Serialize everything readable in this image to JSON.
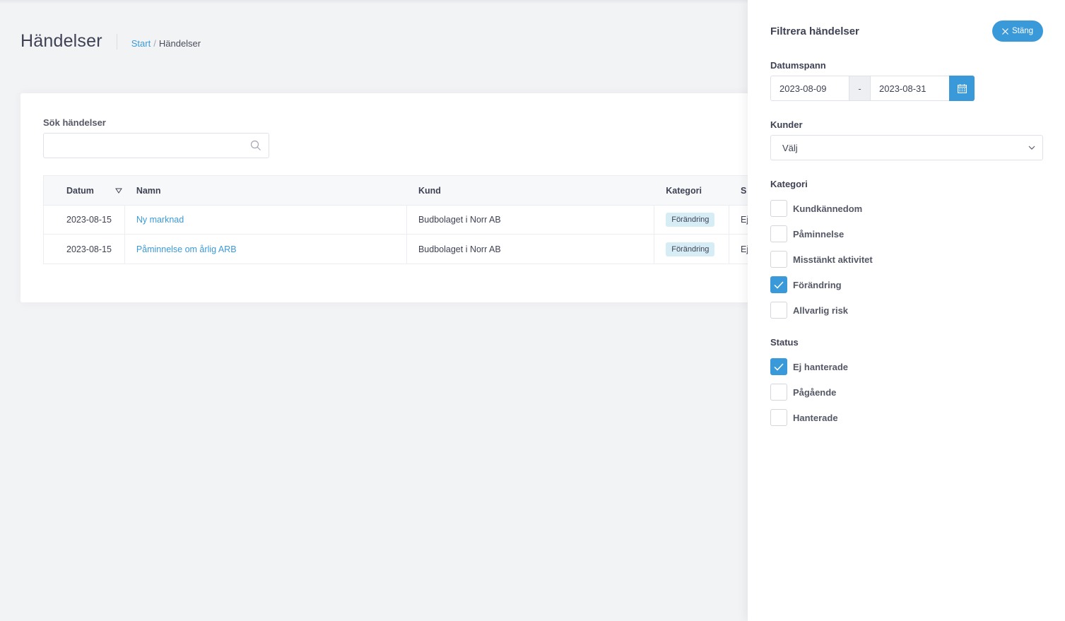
{
  "header": {
    "title": "Händelser",
    "breadcrumb": {
      "start": "Start",
      "separator": "/",
      "current": "Händelser"
    }
  },
  "search": {
    "label": "Sök händelser",
    "placeholder": "",
    "value": ""
  },
  "table": {
    "columns": [
      "Datum",
      "Namn",
      "Kund",
      "Kategori",
      "S"
    ],
    "rows": [
      {
        "datum": "2023-08-15",
        "namn": "Ny marknad",
        "kund": "Budbolaget i Norr AB",
        "kategori": "Förändring",
        "status": "Ej"
      },
      {
        "datum": "2023-08-15",
        "namn": "Påminnelse om årlig ARB",
        "kund": "Budbolaget i Norr AB",
        "kategori": "Förändring",
        "status": "Ej"
      }
    ]
  },
  "filter_panel": {
    "title": "Filtrera händelser",
    "close_label": "Stäng",
    "date_range": {
      "label": "Datumspann",
      "from": "2023-08-09",
      "separator": "-",
      "to": "2023-08-31"
    },
    "customers": {
      "label": "Kunder",
      "selected": "Välj"
    },
    "category": {
      "label": "Kategori",
      "options": [
        {
          "label": "Kundkännedom",
          "checked": false
        },
        {
          "label": "Påminnelse",
          "checked": false
        },
        {
          "label": "Misstänkt aktivitet",
          "checked": false
        },
        {
          "label": "Förändring",
          "checked": true
        },
        {
          "label": "Allvarlig risk",
          "checked": false
        }
      ]
    },
    "status": {
      "label": "Status",
      "options": [
        {
          "label": "Ej hanterade",
          "checked": true
        },
        {
          "label": "Pågående",
          "checked": false
        },
        {
          "label": "Hanterade",
          "checked": false
        }
      ]
    }
  },
  "colors": {
    "accent": "#3a9ad9",
    "badge_bg": "#d6edf6",
    "page_bg": "#f2f3f5"
  }
}
